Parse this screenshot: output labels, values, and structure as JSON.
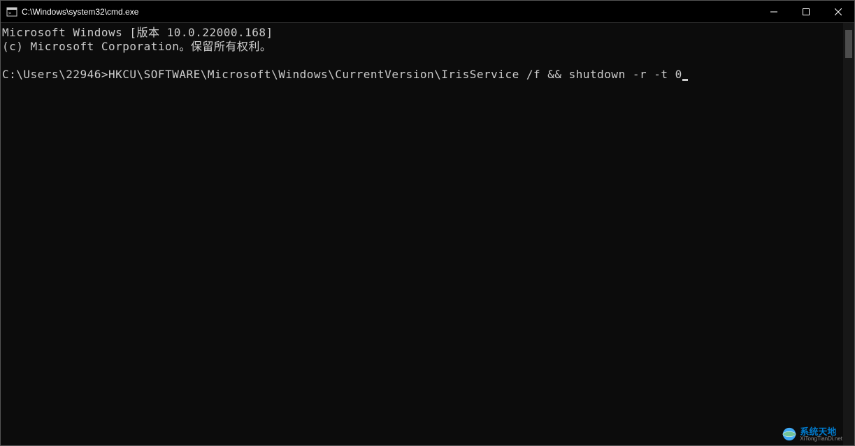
{
  "titlebar": {
    "title": "C:\\Windows\\system32\\cmd.exe"
  },
  "terminal": {
    "line1": "Microsoft Windows [版本 10.0.22000.168]",
    "line2": "(c) Microsoft Corporation。保留所有权利。",
    "blank": "",
    "prompt": "C:\\Users\\22946>",
    "command": "HKCU\\SOFTWARE\\Microsoft\\Windows\\CurrentVersion\\IrisService /f && shutdown -r -t 0"
  },
  "watermark": {
    "main": "系统天地",
    "sub": "XiTongTianDi.net"
  }
}
